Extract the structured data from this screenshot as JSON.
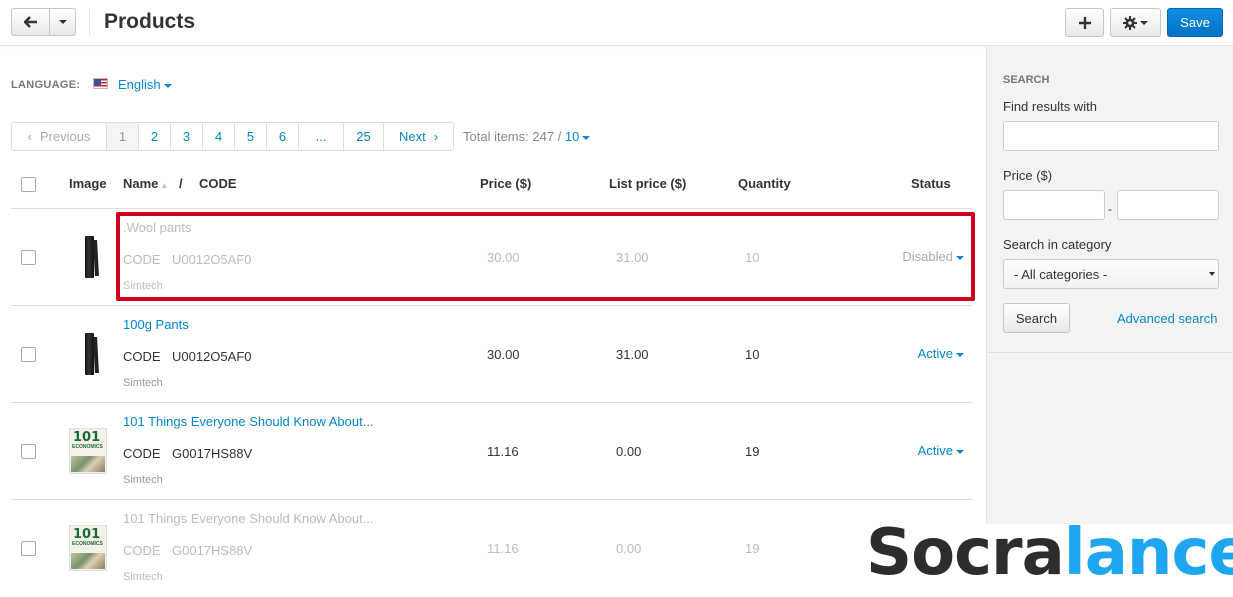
{
  "header": {
    "title": "Products",
    "save_label": "Save"
  },
  "language": {
    "label": "LANGUAGE:",
    "value": "English"
  },
  "pagination": {
    "previous": "Previous",
    "pages": [
      "1",
      "2",
      "3",
      "4",
      "5",
      "6",
      "...",
      "25"
    ],
    "active_page": "1",
    "next": "Next",
    "total_label": "Total items: 247 /",
    "per_page": "10"
  },
  "table": {
    "columns": {
      "image": "Image",
      "name": "Name",
      "sep": "/",
      "code": "CODE",
      "price": "Price ($)",
      "list_price": "List price ($)",
      "quantity": "Quantity",
      "status": "Status"
    },
    "rows": [
      {
        "name": ".Wool pants",
        "code_label": "CODE",
        "code": "U0012O5AF0",
        "vendor": "Simtech",
        "price": "30.00",
        "list_price": "31.00",
        "quantity": "10",
        "status": "Disabled",
        "thumb": "pants-image"
      },
      {
        "name": "100g Pants",
        "code_label": "CODE",
        "code": "U0012O5AF0",
        "vendor": "Simtech",
        "price": "30.00",
        "list_price": "31.00",
        "quantity": "10",
        "status": "Active",
        "thumb": "pants-image"
      },
      {
        "name": "101 Things Everyone Should Know About...",
        "code_label": "CODE",
        "code": "G0017HS88V",
        "vendor": "Simtech",
        "price": "11.16",
        "list_price": "0.00",
        "quantity": "19",
        "status": "Active",
        "thumb": "book-image"
      },
      {
        "name": "101 Things Everyone Should Know About...",
        "code_label": "CODE",
        "code": "G0017HS88V",
        "vendor": "Simtech",
        "price": "11.16",
        "list_price": "0.00",
        "quantity": "19",
        "status": "",
        "thumb": "book-image"
      }
    ]
  },
  "book_cover": {
    "big": "101",
    "small": "ECONOMICS"
  },
  "sidebar": {
    "title": "SEARCH",
    "find_label": "Find results with",
    "price_label": "Price ($)",
    "price_dash": "-",
    "category_label": "Search in category",
    "category_value": "- All categories -",
    "search_button": "Search",
    "advanced_search": "Advanced search"
  },
  "watermark": {
    "part1": "Socra",
    "part2": "lance"
  },
  "colors": {
    "accent": "#0388cc",
    "save_button": "#0570c4",
    "highlight": "#d0021b",
    "watermark_dark": "#2d2d2d",
    "watermark_blue": "#1ea7f0"
  }
}
